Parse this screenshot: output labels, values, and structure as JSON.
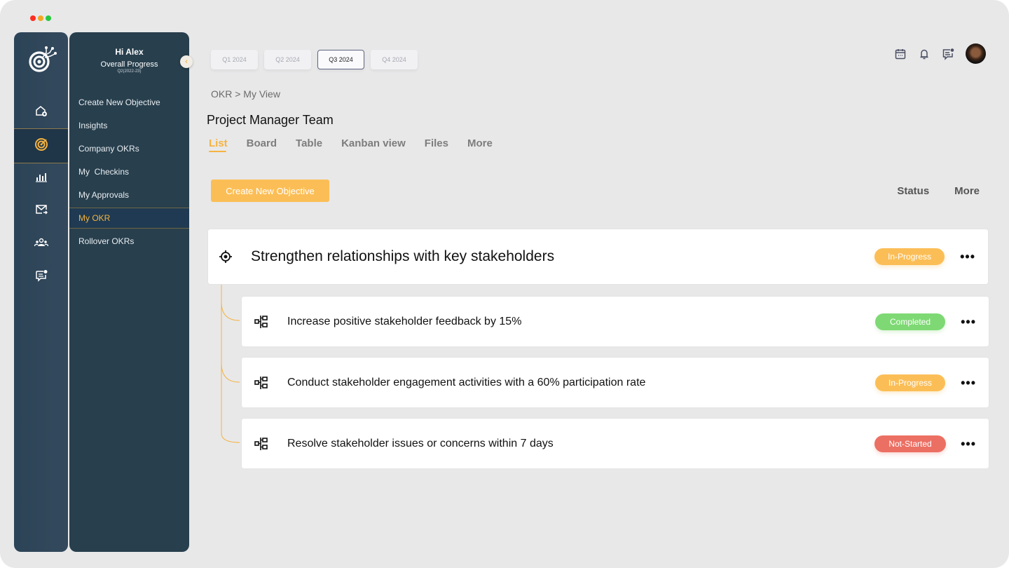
{
  "window": {
    "controls": [
      "close",
      "minimize",
      "maximize"
    ],
    "control_colors": [
      "#ff2d20",
      "#f5a623",
      "#28c840"
    ]
  },
  "rail": {
    "logo": "target-network-logo",
    "items": [
      {
        "icon": "home-add-icon",
        "active": false
      },
      {
        "icon": "target-icon",
        "active": true
      },
      {
        "icon": "bar-chart-icon",
        "active": false
      },
      {
        "icon": "mail-forward-icon",
        "active": false
      },
      {
        "icon": "team-icon",
        "active": false
      },
      {
        "icon": "chat-notification-icon",
        "active": false
      }
    ]
  },
  "subnav": {
    "greeting": "Hi Alex",
    "progress_label": "Overall Progress",
    "period": "Q2(2022-23)",
    "items": [
      {
        "label": "Create New Objective",
        "active": false
      },
      {
        "label": "Insights",
        "active": false
      },
      {
        "label": "Company OKRs",
        "active": false
      },
      {
        "label": "My  Checkins",
        "active": false
      },
      {
        "label": "My Approvals",
        "active": false
      },
      {
        "label": "My OKR",
        "active": true
      },
      {
        "label": "Rollover OKRs",
        "active": false
      }
    ]
  },
  "quarters": [
    {
      "label": "Q1 2024",
      "active": false
    },
    {
      "label": "Q2 2024",
      "active": false
    },
    {
      "label": "Q3 2024",
      "active": true
    },
    {
      "label": "Q4 2024",
      "active": false
    }
  ],
  "header_icons": [
    "calendar-icon",
    "bell-icon",
    "message-icon",
    "user-avatar"
  ],
  "breadcrumb": "OKR > My View",
  "page_title": "Project Manager Team",
  "tabs": [
    {
      "label": "List",
      "active": true
    },
    {
      "label": "Board",
      "active": false
    },
    {
      "label": "Table",
      "active": false
    },
    {
      "label": "Kanban view",
      "active": false
    },
    {
      "label": "Files",
      "active": false
    },
    {
      "label": "More",
      "active": false
    }
  ],
  "create_button": "Create New Objective",
  "right_actions": {
    "status": "Status",
    "more": "More"
  },
  "status_colors": {
    "In-Progress": "#fbbe56",
    "Completed": "#7ed974",
    "Not-Started": "#ec6f63"
  },
  "objective": {
    "title": "Strengthen relationships with key stakeholders",
    "status": "In-Progress",
    "menu": "•••"
  },
  "key_results": [
    {
      "title": "Increase positive stakeholder feedback by 15%",
      "status": "Completed",
      "menu": "•••"
    },
    {
      "title": "Conduct stakeholder engagement activities with a 60% participation rate",
      "status": "In-Progress",
      "menu": "•••"
    },
    {
      "title": "Resolve stakeholder issues or concerns within 7 days",
      "status": "Not-Started",
      "menu": "•••"
    }
  ]
}
